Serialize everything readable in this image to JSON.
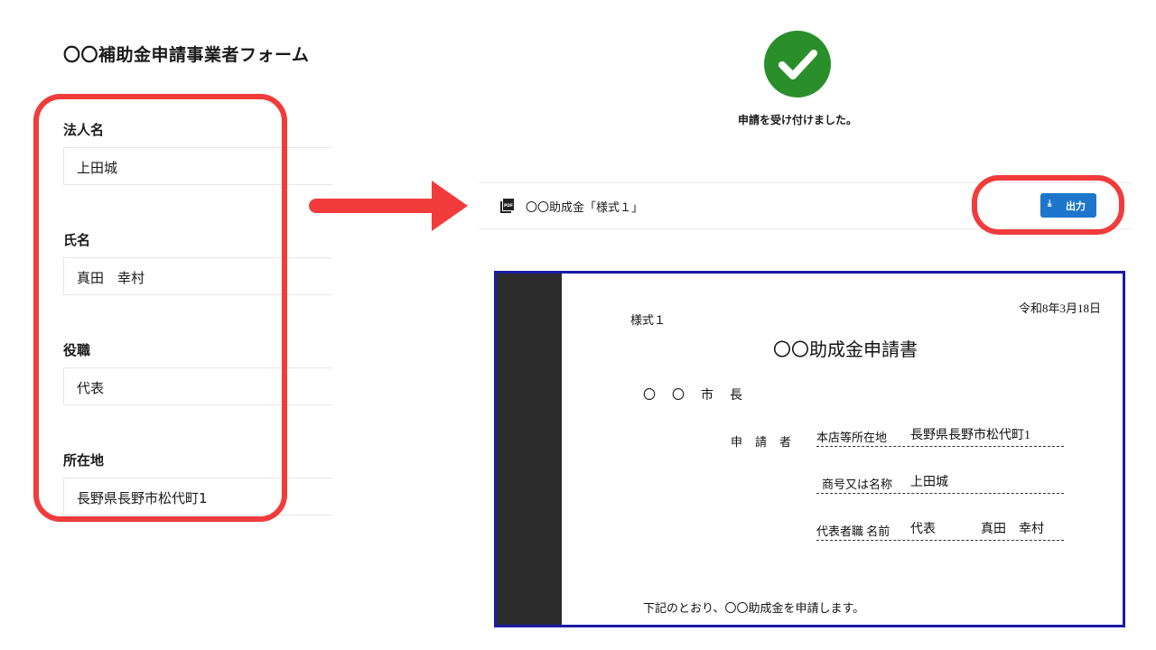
{
  "form": {
    "title": "〇〇補助金申請事業者フォーム",
    "fields": [
      {
        "label": "法人名",
        "value": "上田城"
      },
      {
        "label": "氏名",
        "value": "真田　幸村"
      },
      {
        "label": "役職",
        "value": "代表"
      },
      {
        "label": "所在地",
        "value": "長野県長野市松代町1"
      }
    ]
  },
  "confirmation": {
    "message": "申請を受け付けました。",
    "file_name": "〇〇助成金「様式１」",
    "export_label": "出力",
    "pdf_icon_text": "PDF"
  },
  "document": {
    "date": "令和8年3月18日",
    "form_no": "様式１",
    "title": "〇〇助成金申請書",
    "addressee": "〇〇市長",
    "applicant_label": "申請者",
    "address_label": "本店等所在地",
    "address_value": "長野県長野市松代町1",
    "company_label": "商号又は名称",
    "company_value": "上田城",
    "rep_label": "代表者職 名前",
    "rep_title": "代表",
    "rep_name": "真田　幸村",
    "body": "下記のとおり、〇〇助成金を申請します。"
  },
  "colors": {
    "highlight": "#f23b3b",
    "success": "#2a8f2a",
    "button": "#1e76cc",
    "doc_border": "#1c1aa6"
  }
}
